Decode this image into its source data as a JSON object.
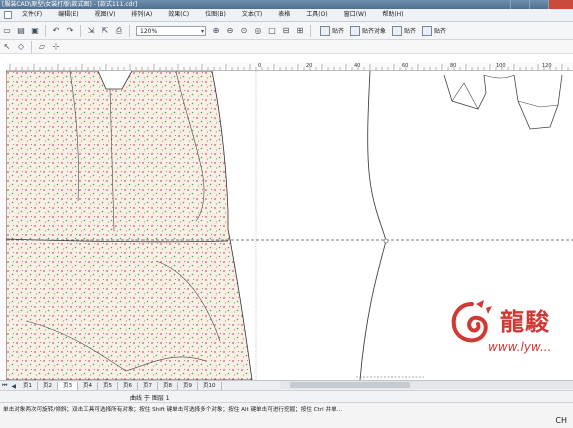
{
  "window": {
    "title": "[服装CAD\\原型\\女装打版\\款式图] - [款式111.cdr]"
  },
  "menu": {
    "items": [
      "文件(F)",
      "编辑(E)",
      "视图(V)",
      "排列(A)",
      "效果(C)",
      "位图(B)",
      "文本(T)",
      "表格",
      "工具(O)",
      "窗口(W)",
      "帮助(H)"
    ]
  },
  "toolbar": {
    "zoom": "120%",
    "snap_buttons": [
      "贴齐",
      "贴齐对象",
      "贴齐",
      "贴齐"
    ]
  },
  "ruler": {
    "top_ticks": [
      "0",
      "20",
      "40",
      "60",
      "80",
      "100",
      "120"
    ]
  },
  "pages": {
    "tabs": [
      "页1",
      "页2",
      "页3",
      "页4",
      "页5",
      "页6",
      "页7",
      "页8",
      "页9",
      "页10"
    ],
    "active_index": 2
  },
  "info": {
    "object_status": "曲线 于 图层 1"
  },
  "status": {
    "hint": "单击对象两次可旋转/倾斜；双击工具可选择所有对象；按住 Shift 键单击可选择多个对象；按住 Alt 键单击可进行挖掘；按住 Ctrl 并单..."
  },
  "brand": {
    "cn": "龍駿",
    "url": "www.lyw...",
    "corner": "CH"
  },
  "colors": {
    "fabric_dot_red": "#e05064",
    "fabric_dot_green": "#5aa05a",
    "fabric_bg": "#f6f0e6",
    "brand_red": "#d13a34",
    "title_bar": "#5b7b9d"
  }
}
